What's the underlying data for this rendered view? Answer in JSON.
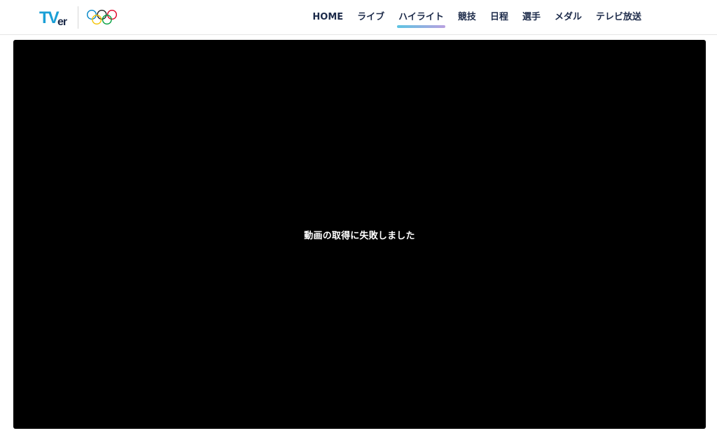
{
  "header": {
    "logo_text": "TVer",
    "partner_logo": "olympic-rings",
    "nav": [
      {
        "label": "HOME",
        "active": false
      },
      {
        "label": "ライブ",
        "active": false
      },
      {
        "label": "ハイライト",
        "active": true
      },
      {
        "label": "競技",
        "active": false
      },
      {
        "label": "日程",
        "active": false
      },
      {
        "label": "選手",
        "active": false
      },
      {
        "label": "メダル",
        "active": false
      },
      {
        "label": "テレビ放送",
        "active": false
      }
    ]
  },
  "player": {
    "error_message": "動画の取得に失敗しました"
  },
  "colors": {
    "nav_text": "#1d2b4a",
    "brand_blue": "#1a9fd6",
    "brand_dark": "#1d2b4a",
    "active_underline_start": "#5cc4e2",
    "active_underline_end": "#b9a0e0",
    "player_bg": "#000000"
  }
}
